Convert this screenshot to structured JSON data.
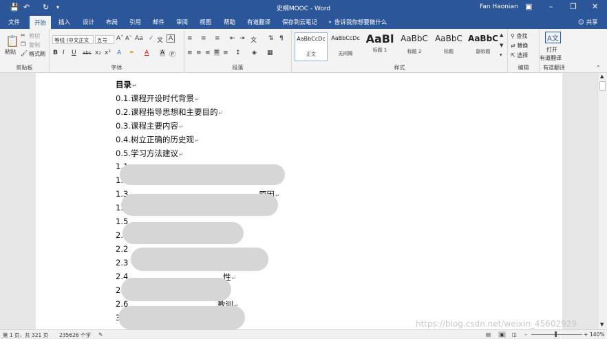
{
  "window": {
    "title": "史纲MOOC - Word",
    "user": "Fan Haonian"
  },
  "tabs": [
    "文件",
    "开始",
    "插入",
    "设计",
    "布局",
    "引用",
    "邮件",
    "审阅",
    "视图",
    "帮助",
    "有道翻译",
    "保存到云笔记"
  ],
  "tell_me": "告诉我你想要做什么",
  "share": "共享",
  "ribbon": {
    "clipboard": {
      "paste": "粘贴",
      "cut": "剪切",
      "copy": "复制",
      "format_painter": "格式刷",
      "label": "剪贴板"
    },
    "font": {
      "name": "等线 (中文正文",
      "size": "五号",
      "label": "字体"
    },
    "paragraph": {
      "label": "段落"
    },
    "styles": {
      "items": [
        {
          "preview": "AaBbCcDc",
          "name": "正文"
        },
        {
          "preview": "AaBbCcDc",
          "name": "无间隔"
        },
        {
          "preview": "AaBl",
          "name": "标题 1"
        },
        {
          "preview": "AaBbC",
          "name": "标题 2"
        },
        {
          "preview": "AaBbC",
          "name": "标题"
        },
        {
          "preview": "AaBbC",
          "name": "副标题"
        }
      ],
      "label": "样式"
    },
    "editing": {
      "find": "查找",
      "replace": "替换",
      "select": "选择",
      "label": "编辑"
    },
    "youdao": {
      "open": "打开",
      "name": "有道翻译",
      "label": "有道翻译"
    }
  },
  "document": {
    "lines": [
      "目录",
      "0.1.课程开设时代背景",
      "0.2.课程指导思想和主要目的",
      "0.3.课程主要内容",
      "0.4.树立正确的历史观",
      "0.5.学习方法建议",
      "1.1",
      "1.2",
      "1.3",
      "1.",
      "1.5",
      "2.1",
      "2.2",
      "2.3",
      "2.4",
      "2.",
      "2.6",
      "3."
    ],
    "partial_text": {
      "line8_tail": "原因",
      "line14_tail": "性",
      "line16_tail": "教训"
    }
  },
  "status": {
    "page": "第 1 页，共 321 页",
    "words": "235626 个字",
    "zoom": "140%"
  },
  "watermark": "https://blog.csdn.net/weixin_45602929"
}
